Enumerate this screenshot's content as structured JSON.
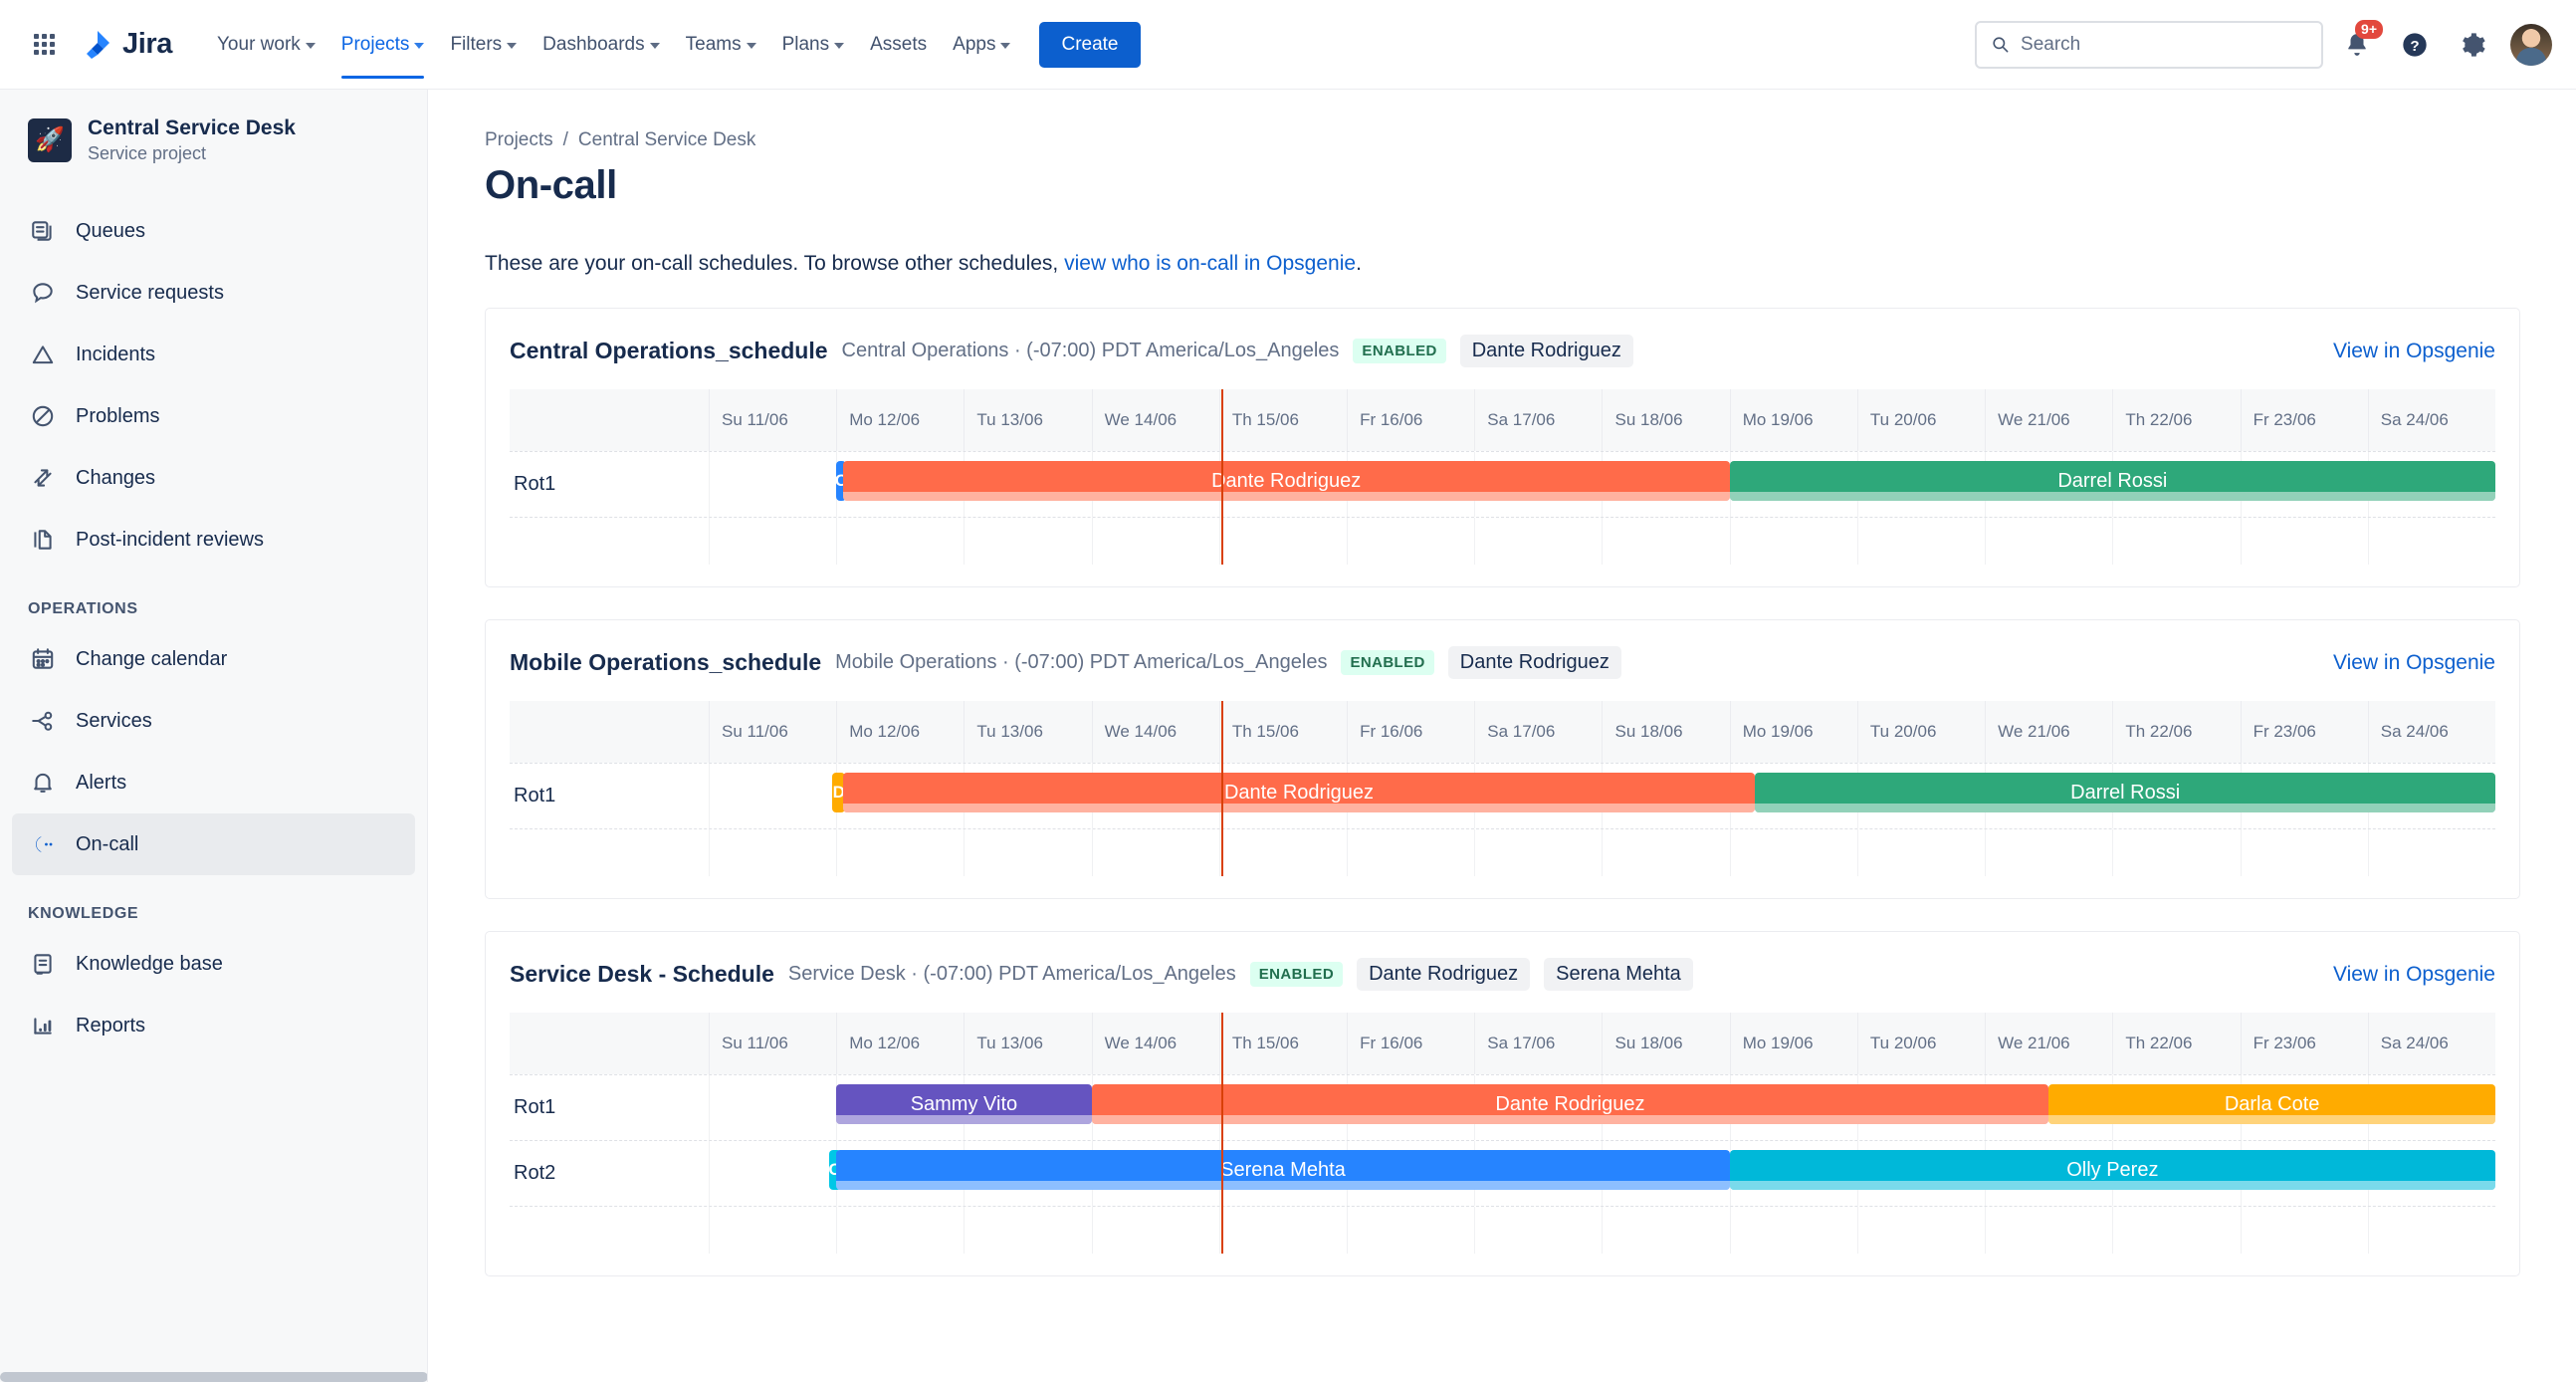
{
  "topnav": {
    "app_switcher_icon": "grid-apps-icon",
    "brand": "Jira",
    "items": [
      {
        "label": "Your work",
        "has_chevron": true,
        "active": false
      },
      {
        "label": "Projects",
        "has_chevron": true,
        "active": true
      },
      {
        "label": "Filters",
        "has_chevron": true,
        "active": false
      },
      {
        "label": "Dashboards",
        "has_chevron": true,
        "active": false
      },
      {
        "label": "Teams",
        "has_chevron": true,
        "active": false
      },
      {
        "label": "Plans",
        "has_chevron": true,
        "active": false
      },
      {
        "label": "Assets",
        "has_chevron": false,
        "active": false
      },
      {
        "label": "Apps",
        "has_chevron": true,
        "active": false
      }
    ],
    "create_label": "Create",
    "search": {
      "placeholder": "Search",
      "value": ""
    },
    "notifications": {
      "badge": "9+",
      "icon": "bell-notification-icon"
    },
    "help_icon": "question-circle-icon",
    "settings_icon": "gear-icon",
    "avatar": "user-avatar"
  },
  "sidebar": {
    "project": {
      "name": "Central Service Desk",
      "subtitle": "Service project",
      "icon": "rocket-icon"
    },
    "items": [
      {
        "label": "Queues",
        "icon": "queues-icon",
        "selected": false
      },
      {
        "label": "Service requests",
        "icon": "comment-icon",
        "selected": false
      },
      {
        "label": "Incidents",
        "icon": "warning-triangle-icon",
        "selected": false
      },
      {
        "label": "Problems",
        "icon": "no-entry-icon",
        "selected": false
      },
      {
        "label": "Changes",
        "icon": "changes-arrows-icon",
        "selected": false
      }
    ],
    "items2": [
      {
        "label": "Post-incident reviews",
        "icon": "document-icon",
        "selected": false
      }
    ],
    "group_operations": "OPERATIONS",
    "operations": [
      {
        "label": "Change calendar",
        "icon": "calendar-icon",
        "selected": false
      },
      {
        "label": "Services",
        "icon": "services-nodes-icon",
        "selected": false
      },
      {
        "label": "Alerts",
        "icon": "bell-icon",
        "selected": false
      },
      {
        "label": "On-call",
        "icon": "phone-oncall-icon",
        "selected": true
      }
    ],
    "group_knowledge": "KNOWLEDGE",
    "knowledge": [
      {
        "label": "Knowledge base",
        "icon": "book-icon",
        "selected": false
      },
      {
        "label": "Reports",
        "icon": "bar-chart-icon",
        "selected": false
      }
    ]
  },
  "main": {
    "breadcrumb": [
      "Projects",
      "Central Service Desk"
    ],
    "breadcrumb_separator": "/",
    "page_title": "On-call",
    "intro_text_before": "These are your on-call schedules. To browse other schedules, ",
    "intro_link": "view who is on-call in Opsgenie",
    "intro_text_after": "."
  },
  "chart_data": {
    "type": "timeline",
    "days": [
      "Su 11/06",
      "Mo 12/06",
      "Tu 13/06",
      "We 14/06",
      "Th 15/06",
      "Fr 16/06",
      "Sa 17/06",
      "Su 18/06",
      "Mo 19/06",
      "Tu 20/06",
      "We 21/06",
      "Th 22/06",
      "Fr 23/06",
      "Sa 24/06"
    ],
    "now_marker_day_index": 4,
    "now_marker_fraction": 0.02,
    "enabled_label": "ENABLED",
    "view_link_label": "View in Opsgenie",
    "schedules": [
      {
        "name": "Central Operations_schedule",
        "meta": "Central Operations · (-07:00) PDT America/Los_Angeles",
        "status": "ENABLED",
        "participants": [
          "Dante Rodriguez"
        ],
        "link": "View in Opsgenie",
        "rotations": [
          {
            "label": "Rot1",
            "shifts": [
              {
                "name": "O",
                "short": true,
                "start": 1.0,
                "end": 1.08,
                "color": "#2684FF"
              },
              {
                "name": "Dante Rodriguez",
                "short": false,
                "start": 1.05,
                "end": 8.0,
                "color": "#FF6B4A"
              },
              {
                "name": "Darrel Rossi",
                "short": false,
                "start": 8.0,
                "end": 14.0,
                "color": "#2EA87A"
              }
            ]
          }
        ]
      },
      {
        "name": "Mobile Operations_schedule",
        "meta": "Mobile Operations · (-07:00) PDT America/Los_Angeles",
        "status": "ENABLED",
        "participants": [
          "Dante Rodriguez"
        ],
        "link": "View in Opsgenie",
        "rotations": [
          {
            "label": "Rot1",
            "shifts": [
              {
                "name": "D",
                "short": true,
                "start": 0.97,
                "end": 1.07,
                "color": "#FFAB00"
              },
              {
                "name": "Dante Rodriguez",
                "short": false,
                "start": 1.05,
                "end": 8.2,
                "color": "#FF6B4A"
              },
              {
                "name": "Darrel Rossi",
                "short": false,
                "start": 8.2,
                "end": 14.0,
                "color": "#2EA87A"
              }
            ]
          }
        ]
      },
      {
        "name": "Service Desk - Schedule",
        "meta": "Service Desk · (-07:00) PDT America/Los_Angeles",
        "status": "ENABLED",
        "participants": [
          "Dante Rodriguez",
          "Serena Mehta"
        ],
        "link": "View in Opsgenie",
        "rotations": [
          {
            "label": "Rot1",
            "shifts": [
              {
                "name": "Sammy Vito",
                "short": false,
                "start": 1.0,
                "end": 3.0,
                "color": "#6554C0"
              },
              {
                "name": "Dante Rodriguez",
                "short": false,
                "start": 3.0,
                "end": 10.5,
                "color": "#FF6B4A"
              },
              {
                "name": "Darla Cote",
                "short": false,
                "start": 10.5,
                "end": 14.0,
                "color": "#FFAB00"
              }
            ]
          },
          {
            "label": "Rot2",
            "shifts": [
              {
                "name": "O",
                "short": true,
                "start": 0.94,
                "end": 1.04,
                "color": "#00C7E6"
              },
              {
                "name": "Serena Mehta",
                "short": false,
                "start": 1.0,
                "end": 8.0,
                "color": "#2684FF"
              },
              {
                "name": "Olly Perez",
                "short": false,
                "start": 8.0,
                "end": 14.0,
                "color": "#00B8D9"
              }
            ]
          }
        ]
      }
    ]
  }
}
